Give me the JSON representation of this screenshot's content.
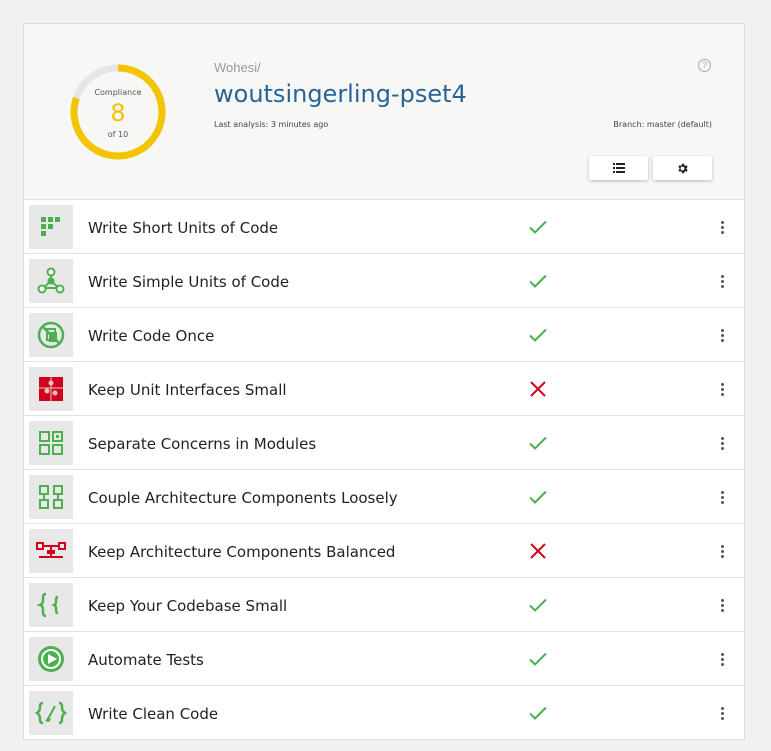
{
  "colors": {
    "pass": "#4caf50",
    "fail": "#d0021b",
    "gauge": "#f5c400",
    "link": "#2a6496"
  },
  "gauge": {
    "title": "Compliance",
    "value": "8",
    "sub": "of 10",
    "fraction": 0.8
  },
  "header": {
    "owner": "Wohesi/",
    "repo": "woutsingerling-pset4",
    "last_analysis": "Last analysis: 3 minutes ago",
    "branch": "Branch: master (default)",
    "help_icon": "question-circle-icon",
    "list_icon": "list-icon",
    "settings_icon": "gear-icon"
  },
  "guidelines": [
    {
      "label": "Write Short Units of Code",
      "status": "pass",
      "icon": "short-units-icon"
    },
    {
      "label": "Write Simple Units of Code",
      "status": "pass",
      "icon": "simple-units-icon"
    },
    {
      "label": "Write Code Once",
      "status": "pass",
      "icon": "code-once-icon"
    },
    {
      "label": "Keep Unit Interfaces Small",
      "status": "fail",
      "icon": "puzzle-icon"
    },
    {
      "label": "Separate Concerns in Modules",
      "status": "pass",
      "icon": "modules-icon"
    },
    {
      "label": "Couple Architecture Components Loosely",
      "status": "pass",
      "icon": "components-icon"
    },
    {
      "label": "Keep Architecture Components Balanced",
      "status": "fail",
      "icon": "balance-icon"
    },
    {
      "label": "Keep Your Codebase Small",
      "status": "pass",
      "icon": "braces-icon"
    },
    {
      "label": "Automate Tests",
      "status": "pass",
      "icon": "play-icon"
    },
    {
      "label": "Write Clean Code",
      "status": "pass",
      "icon": "clean-code-icon"
    }
  ]
}
